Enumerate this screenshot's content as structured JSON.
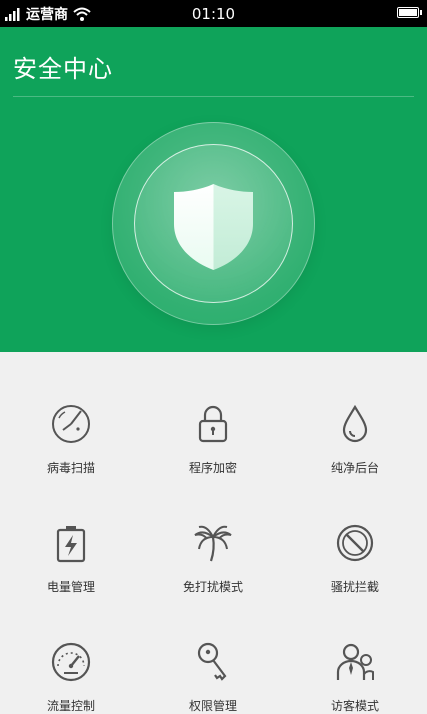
{
  "status_bar": {
    "carrier": "运营商",
    "time": "01:10"
  },
  "header": {
    "title": "安全中心"
  },
  "colors": {
    "header_bg": "#0fa35a",
    "grid_bg": "#f0f0f0",
    "icon_stroke": "#555555"
  },
  "grid": {
    "items": [
      {
        "label": "病毒扫描",
        "icon": "virus-scan-radar-icon"
      },
      {
        "label": "程序加密",
        "icon": "lock-icon"
      },
      {
        "label": "纯净后台",
        "icon": "water-drop-icon"
      },
      {
        "label": "电量管理",
        "icon": "battery-bolt-icon"
      },
      {
        "label": "免打扰模式",
        "icon": "palm-tree-icon"
      },
      {
        "label": "骚扰拦截",
        "icon": "block-icon"
      },
      {
        "label": "流量控制",
        "icon": "speedometer-icon"
      },
      {
        "label": "权限管理",
        "icon": "key-icon"
      },
      {
        "label": "访客模式",
        "icon": "guest-users-icon"
      }
    ]
  }
}
